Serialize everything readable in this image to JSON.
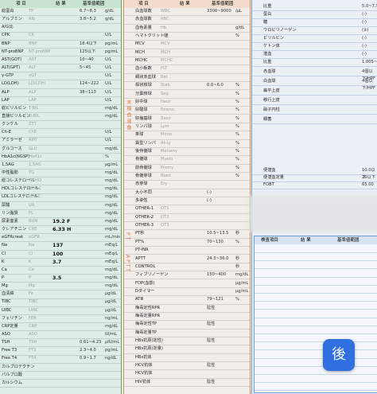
{
  "left_panel": {
    "header": {
      "item": "項 目",
      "result": "結 果",
      "ref": "基準値範囲"
    },
    "rows": [
      {
        "name": "総蛋白",
        "abbr": "TP",
        "value": "",
        "ref": "6.7~8.3",
        "unit": "g/dL"
      },
      {
        "name": "アルブミン",
        "abbr": "Alb",
        "value": "",
        "ref": "3.8~5.2",
        "unit": "g/dL"
      },
      {
        "name": "A/G比",
        "abbr": "",
        "value": "",
        "ref": "",
        "unit": ""
      },
      {
        "name": "CPK",
        "abbr": "CK",
        "value": "",
        "ref": "",
        "unit": "U/L"
      },
      {
        "name": "BNP",
        "abbr": "BNP",
        "value": "",
        "ref": "18.4以下",
        "unit": "pg/mL"
      },
      {
        "name": "NT-proBNP",
        "abbr": "NT-proBNP",
        "value": "",
        "ref": "125以下",
        "unit": "pg/mL"
      },
      {
        "name": "AST(GOT)",
        "abbr": "AST",
        "value": "",
        "ref": "10~40",
        "unit": "U/L"
      },
      {
        "name": "ALT(GPT)",
        "abbr": "ALT",
        "value": "",
        "ref": "5~45",
        "unit": "U/L"
      },
      {
        "name": "γ-GTP",
        "abbr": "γGT",
        "value": "",
        "ref": "",
        "unit": "U/L"
      },
      {
        "name": "LD(LDH)",
        "abbr": "LD(LDH)",
        "value": "",
        "ref": "124~222",
        "unit": "U/L"
      },
      {
        "name": "ALP",
        "abbr": "ALP",
        "value": "",
        "ref": "38~113",
        "unit": "U/L"
      },
      {
        "name": "LAP",
        "abbr": "LAP",
        "value": "",
        "ref": "",
        "unit": "U/L"
      },
      {
        "name": "総ビリルビン",
        "abbr": "T-BIL",
        "value": "",
        "ref": "",
        "unit": "mg/dL"
      },
      {
        "name": "直接ビリルビン",
        "abbr": "D-BIL",
        "value": "",
        "ref": "",
        "unit": "mg/dL"
      },
      {
        "name": "クンケル",
        "abbr": "ZTT",
        "value": "",
        "ref": "",
        "unit": ""
      },
      {
        "name": "Ch-E",
        "abbr": "ChE",
        "value": "",
        "ref": "",
        "unit": "U/L"
      },
      {
        "name": "アミラーゼ",
        "abbr": "AMY",
        "value": "",
        "ref": "",
        "unit": "U/L"
      },
      {
        "name": "グルコース",
        "abbr": "GLU",
        "value": "",
        "ref": "",
        "unit": "mg/dL"
      },
      {
        "name": "HbA1c(NGSP)",
        "abbr": "HbA1c",
        "value": "",
        "ref": "",
        "unit": "%"
      },
      {
        "name": "1,5AG",
        "abbr": "1,5AG",
        "value": "",
        "ref": "",
        "unit": "μg/mL"
      },
      {
        "name": "中性脂肪",
        "abbr": "TG",
        "value": "",
        "ref": "",
        "unit": "mg/dL"
      },
      {
        "name": "総コレステロール",
        "abbr": "T-CHO",
        "value": "",
        "ref": "",
        "unit": "mg/dL"
      },
      {
        "name": "HDLコレステロール",
        "abbr": "HDL-C",
        "value": "",
        "ref": "",
        "unit": "mg/dL"
      },
      {
        "name": "LDLコレステロール",
        "abbr": "LDL-C",
        "value": "",
        "ref": "",
        "unit": "mg/dL"
      },
      {
        "name": "尿酸",
        "abbr": "UA",
        "value": "",
        "ref": "",
        "unit": "mg/dL"
      },
      {
        "name": "リン脂質",
        "abbr": "PL",
        "value": "",
        "ref": "",
        "unit": "mg/dL"
      },
      {
        "name": "尿素窒素",
        "abbr": "BUN",
        "value": "19.2 F",
        "ref": "",
        "unit": "mg/dL"
      },
      {
        "name": "クレアチニン",
        "abbr": "CRE",
        "value": "6.33 H",
        "ref": "",
        "unit": "mg/dL"
      },
      {
        "name": "eGFRcreat",
        "abbr": "eGFR",
        "value": "",
        "ref": "",
        "unit": "mL/min"
      },
      {
        "name": "Na",
        "abbr": "Na",
        "value": "137",
        "ref": "",
        "unit": "mEq/L"
      },
      {
        "name": "Cl",
        "abbr": "Cl",
        "value": "100",
        "ref": "",
        "unit": "mEq/L"
      },
      {
        "name": "K",
        "abbr": "K",
        "value": "3.7",
        "ref": "",
        "unit": "mEq/L"
      },
      {
        "name": "Ca",
        "abbr": "Ca",
        "value": "",
        "ref": "",
        "unit": "mg/dL"
      },
      {
        "name": "P",
        "abbr": "P",
        "value": "3.5",
        "ref": "",
        "unit": "mg/dL"
      },
      {
        "name": "Mg",
        "abbr": "Mg",
        "value": "",
        "ref": "",
        "unit": "mg/dL"
      },
      {
        "name": "血清鉄",
        "abbr": "Fe",
        "value": "",
        "ref": "",
        "unit": "μg/dL"
      },
      {
        "name": "TIBC",
        "abbr": "TIBC",
        "value": "",
        "ref": "",
        "unit": "μg/dL"
      },
      {
        "name": "UIBC",
        "abbr": "UIBC",
        "value": "",
        "ref": "",
        "unit": "μg/dL"
      },
      {
        "name": "フェリチン",
        "abbr": "FER",
        "value": "",
        "ref": "",
        "unit": "ng/mL"
      },
      {
        "name": "CRP定量",
        "abbr": "CRP",
        "value": "",
        "ref": "",
        "unit": "mg/dL"
      },
      {
        "name": "ASO",
        "abbr": "ASO",
        "value": "",
        "ref": "",
        "unit": "IU/mL"
      },
      {
        "name": "TSH",
        "abbr": "TSH",
        "value": "",
        "ref": "0.61~4.23",
        "unit": "μIU/mL"
      },
      {
        "name": "Free T3",
        "abbr": "FT3",
        "value": "",
        "ref": "2.3~4.0",
        "unit": "pg/mL"
      },
      {
        "name": "Free T4",
        "abbr": "FT4",
        "value": "",
        "ref": "0.9~1.7",
        "unit": "ng/dL"
      },
      {
        "name": "カルプロテクチン",
        "abbr": "",
        "value": "",
        "ref": "",
        "unit": ""
      },
      {
        "name": "パルプロ酸",
        "abbr": "",
        "value": "",
        "ref": "",
        "unit": ""
      },
      {
        "name": "カルシウム",
        "abbr": "",
        "value": "",
        "ref": "",
        "unit": ""
      }
    ]
  },
  "mid_panel": {
    "header": {
      "item": "項 目",
      "result": "結 果",
      "ref": "基準値範囲"
    },
    "groups": [
      "末梢血液像",
      "PT",
      "APTT"
    ],
    "rows": [
      {
        "name": "白血球数",
        "abbr": "WBC",
        "value": "",
        "ref": "3300~9000",
        "unit": "/μL"
      },
      {
        "name": "赤血球数",
        "abbr": "RBC",
        "value": "",
        "ref": "",
        "unit": ""
      },
      {
        "name": "血色素量",
        "abbr": "Hb",
        "value": "",
        "ref": "",
        "unit": "g/dL"
      },
      {
        "name": "ヘマトクリット値",
        "abbr": "Ht",
        "value": "",
        "ref": "",
        "unit": "%"
      },
      {
        "name": "MCV",
        "abbr": "MCV",
        "value": "",
        "ref": "",
        "unit": ""
      },
      {
        "name": "MCH",
        "abbr": "MCH",
        "value": "",
        "ref": "",
        "unit": ""
      },
      {
        "name": "MCHC",
        "abbr": "MCHC",
        "value": "",
        "ref": "",
        "unit": ""
      },
      {
        "name": "血小板数",
        "abbr": "PLT",
        "value": "",
        "ref": "",
        "unit": ""
      },
      {
        "name": "網状赤血球",
        "abbr": "Ret",
        "value": "",
        "ref": "",
        "unit": ""
      },
      {
        "name": "桿状核球",
        "abbr": "Stab",
        "value": "",
        "ref": "0.0~6.0",
        "unit": "%"
      },
      {
        "name": "分葉核球",
        "abbr": "Seg",
        "value": "",
        "ref": "",
        "unit": "%"
      },
      {
        "name": "好中球",
        "abbr": "Neut",
        "value": "",
        "ref": "",
        "unit": "%"
      },
      {
        "name": "好酸球",
        "abbr": "Eosino",
        "value": "",
        "ref": "",
        "unit": "%"
      },
      {
        "name": "好塩基球",
        "abbr": "Baso",
        "value": "",
        "ref": "",
        "unit": "%"
      },
      {
        "name": "リンパ球",
        "abbr": "Lym",
        "value": "",
        "ref": "",
        "unit": "%"
      },
      {
        "name": "単球",
        "abbr": "Mono",
        "value": "",
        "ref": "",
        "unit": "%"
      },
      {
        "name": "異型リンパ",
        "abbr": "At-Ly",
        "value": "",
        "ref": "",
        "unit": "%"
      },
      {
        "name": "後骨髄球",
        "abbr": "Metamy",
        "value": "",
        "ref": "",
        "unit": "%"
      },
      {
        "name": "骨髄球",
        "abbr": "Myelo",
        "value": "",
        "ref": "",
        "unit": "%"
      },
      {
        "name": "前骨髄球",
        "abbr": "Promy",
        "value": "",
        "ref": "",
        "unit": "%"
      },
      {
        "name": "骨髄芽球",
        "abbr": "Blast",
        "value": "",
        "ref": "",
        "unit": "%"
      },
      {
        "name": "赤芽球",
        "abbr": "Ery",
        "value": "",
        "ref": "",
        "unit": ""
      },
      {
        "name": "大小不同",
        "abbr": "",
        "value": "",
        "ref": "(-)",
        "unit": ""
      },
      {
        "name": "多染性",
        "abbr": "",
        "value": "",
        "ref": "(-)",
        "unit": ""
      },
      {
        "name": "OTHER-1",
        "abbr": "OT1",
        "value": "",
        "ref": "",
        "unit": ""
      },
      {
        "name": "OTHER-2",
        "abbr": "OT2",
        "value": "",
        "ref": "",
        "unit": ""
      },
      {
        "name": "OTHER-3",
        "abbr": "OT3",
        "value": "",
        "ref": "",
        "unit": ""
      },
      {
        "name": "PT秒",
        "abbr": "",
        "value": "",
        "ref": "10.5~13.5",
        "unit": "秒"
      },
      {
        "name": "PT%",
        "abbr": "",
        "value": "",
        "ref": "70~130",
        "unit": "%"
      },
      {
        "name": "PT-INR",
        "abbr": "",
        "value": "",
        "ref": "",
        "unit": ""
      },
      {
        "name": "APTT",
        "abbr": "",
        "value": "",
        "ref": "24.3~36.0",
        "unit": "秒"
      },
      {
        "name": "CONTROL",
        "abbr": "",
        "value": "",
        "ref": "",
        "unit": "秒"
      },
      {
        "name": "フィブリノーゲン",
        "abbr": "",
        "value": "",
        "ref": "150~400",
        "unit": "mg/dL"
      },
      {
        "name": "FDP(血漿)",
        "abbr": "",
        "value": "",
        "ref": "",
        "unit": "μg/mL"
      },
      {
        "name": "Dダイマー",
        "abbr": "",
        "value": "",
        "ref": "",
        "unit": "μg/mL"
      },
      {
        "name": "ATⅢ",
        "abbr": "",
        "value": "",
        "ref": "79~121",
        "unit": "%"
      },
      {
        "name": "梅毒定性RPR",
        "abbr": "",
        "value": "",
        "ref": "陰性",
        "unit": ""
      },
      {
        "name": "梅毒定量RPR",
        "abbr": "",
        "value": "",
        "ref": "",
        "unit": ""
      },
      {
        "name": "梅毒定性TP",
        "abbr": "",
        "value": "",
        "ref": "陰性",
        "unit": ""
      },
      {
        "name": "梅毒定量TP",
        "abbr": "",
        "value": "",
        "ref": "",
        "unit": ""
      },
      {
        "name": "HBs抗原(定性)",
        "abbr": "",
        "value": "",
        "ref": "陰性",
        "unit": ""
      },
      {
        "name": "HBs抗原(定量)",
        "abbr": "",
        "value": "",
        "ref": "",
        "unit": ""
      },
      {
        "name": "HBs抗体",
        "abbr": "",
        "value": "",
        "ref": "",
        "unit": ""
      },
      {
        "name": "HCV抗体",
        "abbr": "",
        "value": "",
        "ref": "陰性",
        "unit": ""
      },
      {
        "name": "HCV抗体",
        "abbr": "",
        "value": "",
        "ref": "",
        "unit": ""
      },
      {
        "name": "HIV抗体",
        "abbr": "",
        "value": "",
        "ref": "陰性",
        "unit": ""
      }
    ]
  },
  "right_panel": {
    "urine_rows": [
      {
        "name": "比重",
        "value": "",
        "ref": "5.0~7.5"
      },
      {
        "name": "蛋白",
        "value": "",
        "ref": "(-)"
      },
      {
        "name": "糖",
        "value": "",
        "ref": "(-)"
      },
      {
        "name": "ウロビリノーゲン",
        "value": "",
        "ref": "(±)"
      },
      {
        "name": "ビリルビン",
        "value": "",
        "ref": "(-)"
      },
      {
        "name": "ケトン体",
        "value": "",
        "ref": "(-)"
      },
      {
        "name": "潜血",
        "value": "",
        "ref": "(-)"
      },
      {
        "name": "比重",
        "value": "",
        "ref": "1.005~1.030"
      }
    ],
    "sediment_rows": [
      {
        "name": "赤血球",
        "ref": "4個以下/HPF"
      },
      {
        "name": "白血球",
        "ref": "4個以下/HPF"
      },
      {
        "name": "扁平上皮",
        "ref": ""
      },
      {
        "name": "移行上皮",
        "ref": ""
      },
      {
        "name": "硝子円柱",
        "ref": ""
      },
      {
        "name": "細菌",
        "ref": ""
      }
    ],
    "other_rows": [
      {
        "name": "便潜血",
        "ref": "10.0以下"
      },
      {
        "name": "便潜血定量",
        "ref": "20以下"
      },
      {
        "name": "FOBT",
        "ref": "65.00"
      }
    ],
    "lower_header": {
      "item": "検査項目",
      "result": "結 果",
      "ref": "基準値範囲"
    },
    "button_label": "後"
  },
  "colors": {
    "left_accent": "#5aa86f",
    "mid_accent": "#e08a55",
    "right_accent": "#6d9ac9",
    "button": "#2f6fe0"
  }
}
